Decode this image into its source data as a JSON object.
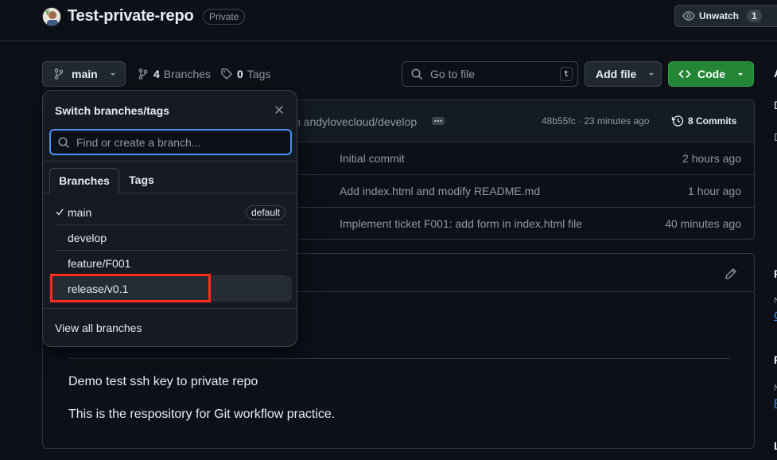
{
  "repo": {
    "name": "Test-private-repo",
    "visibility": "Private"
  },
  "watch": {
    "label": "Unwatch",
    "count": "1"
  },
  "toolbar": {
    "branch": "main",
    "branches_count": "4",
    "branches_label": "Branches",
    "tags_count": "0",
    "tags_label": "Tags",
    "search_placeholder": "Go to file",
    "search_shortcut": "t",
    "add_file": "Add file",
    "code": "Code"
  },
  "commit": {
    "message": "n andylovecloud/develop",
    "hash_time": "48b55fc · 23 minutes ago",
    "commits": "8 Commits"
  },
  "files": [
    {
      "message": "Initial commit",
      "time": "2 hours ago"
    },
    {
      "message": "Add index.html and modify README.md",
      "time": "1 hour ago"
    },
    {
      "message": "Implement ticket F001: add form in index.html file",
      "time": "40 minutes ago"
    }
  ],
  "readme": {
    "p1": "Demo test ssh key to private repo",
    "p2": "This is the respository for Git workflow practice."
  },
  "right_panel": [
    "A",
    "D",
    "D",
    "P",
    "N",
    "C",
    "P",
    "N",
    "F",
    "L"
  ],
  "dropdown": {
    "title": "Switch branches/tags",
    "placeholder": "Find or create a branch...",
    "tabs": [
      "Branches",
      "Tags"
    ],
    "branches": [
      {
        "name": "main",
        "badge": "default",
        "checked": true
      },
      {
        "name": "develop"
      },
      {
        "name": "feature/F001"
      },
      {
        "name": "release/v0.1"
      }
    ],
    "view_all": "View all branches"
  },
  "colors": {
    "accent": "#4493f8",
    "code_btn": "#238636",
    "highlight": "#ff2b1a"
  }
}
